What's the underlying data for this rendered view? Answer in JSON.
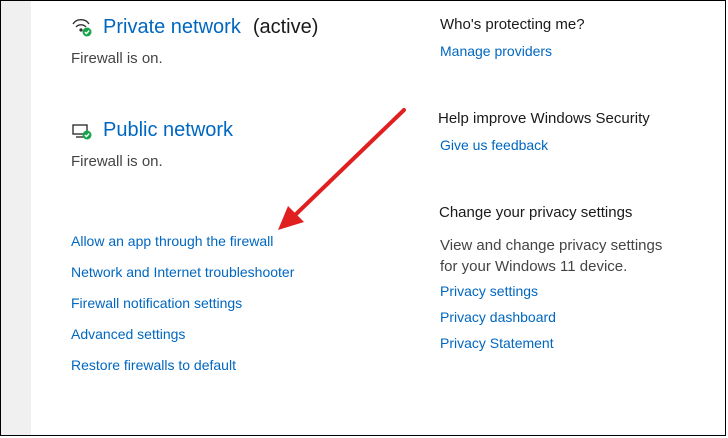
{
  "networks": {
    "private": {
      "title": "Private network",
      "active_label": "(active)",
      "status": "Firewall is on."
    },
    "public": {
      "title": "Public network",
      "status": "Firewall is on."
    }
  },
  "links": {
    "allow_app": "Allow an app through the firewall",
    "troubleshooter": "Network and Internet troubleshooter",
    "notification_settings": "Firewall notification settings",
    "advanced_settings": "Advanced settings",
    "restore_defaults": "Restore firewalls to default"
  },
  "sidebar": {
    "protecting": {
      "heading": "Who's protecting me?",
      "link": "Manage providers"
    },
    "improve": {
      "heading": "Help improve Windows Security",
      "link": "Give us feedback"
    },
    "privacy": {
      "heading": "Change your privacy settings",
      "description": "View and change privacy settings for your Windows 11 device.",
      "links": [
        "Privacy settings",
        "Privacy dashboard",
        "Privacy Statement"
      ]
    }
  },
  "colors": {
    "link": "#0067c0",
    "annotation_arrow": "#e02020",
    "status_ok": "#16a34a"
  },
  "icons": {
    "private": "private-network-icon",
    "public": "public-network-icon",
    "ok": "check-badge-icon"
  }
}
